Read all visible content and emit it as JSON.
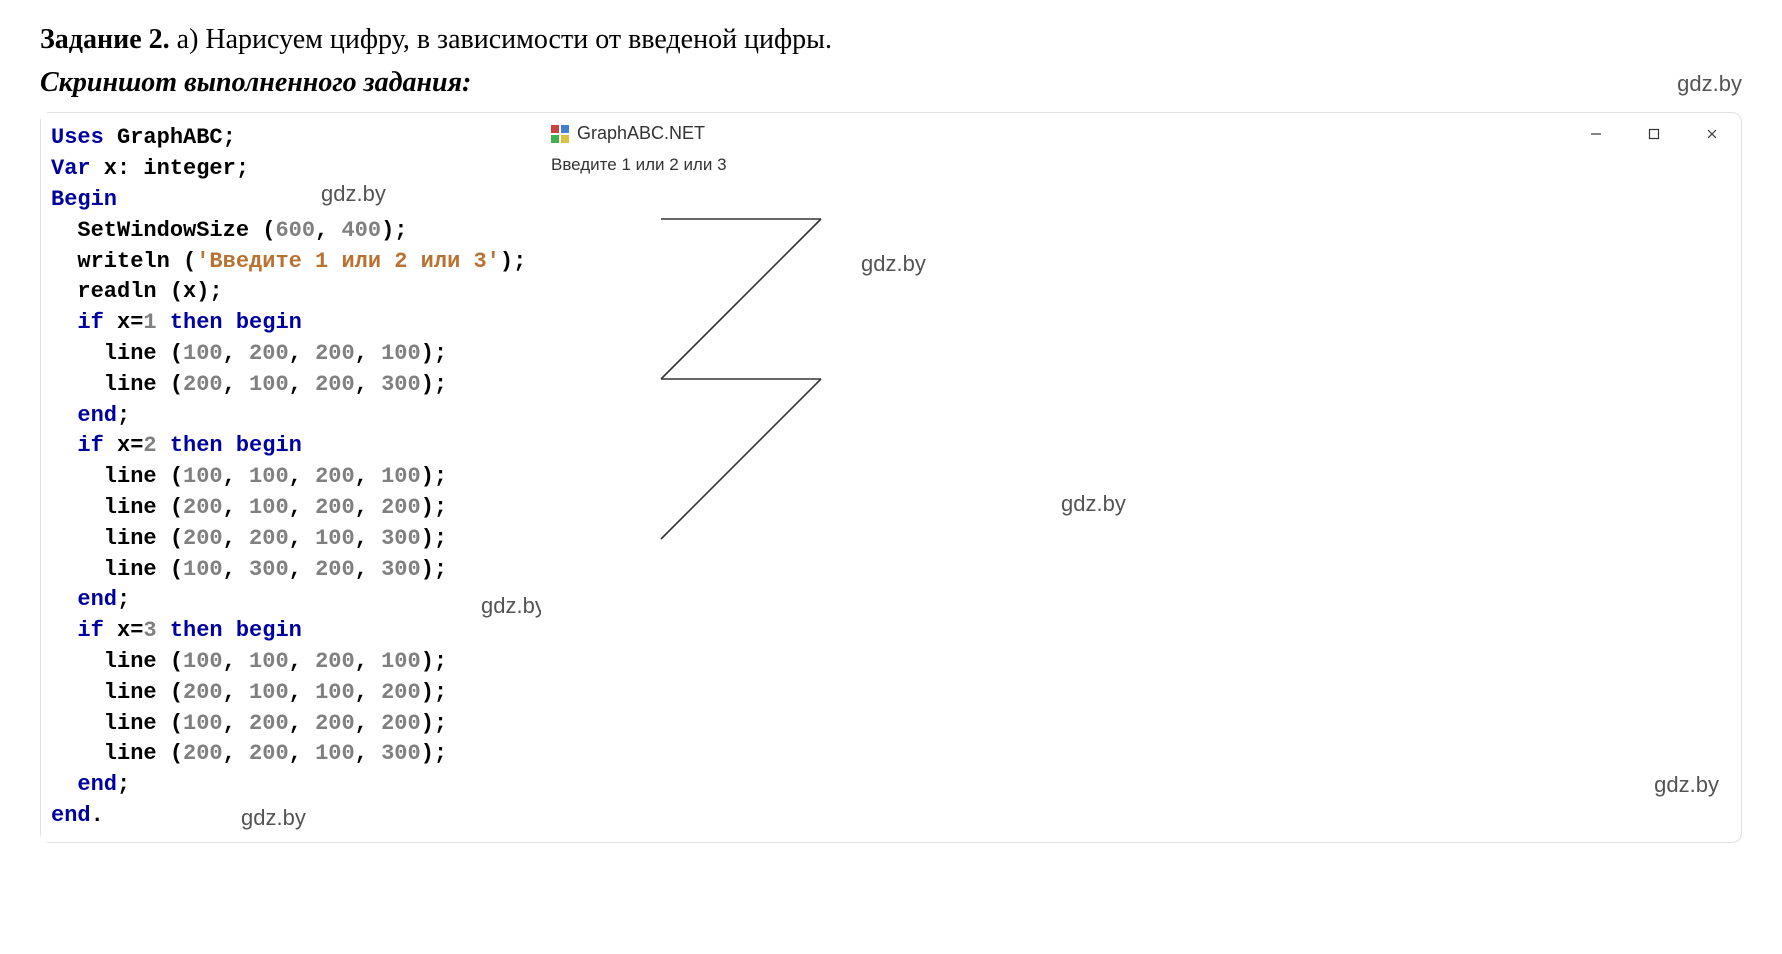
{
  "task": {
    "label": "Задание 2.",
    "letter": "а)",
    "description": "Нарисуем цифру, в зависимости от введеной цифры."
  },
  "subtitle": "Скриншот выполненного задания:",
  "watermark": "gdz.by",
  "code": {
    "lines": [
      [
        {
          "t": "Uses",
          "c": "kw"
        },
        {
          "t": " GraphABC;",
          "c": "punct"
        }
      ],
      [
        {
          "t": "Var",
          "c": "kw"
        },
        {
          "t": " x: ",
          "c": "punct"
        },
        {
          "t": "integer",
          "c": "ident"
        },
        {
          "t": ";",
          "c": "punct"
        }
      ],
      [
        {
          "t": "Begin",
          "c": "kw"
        }
      ],
      [
        {
          "t": "  SetWindowSize (",
          "c": "punct"
        },
        {
          "t": "600",
          "c": "num"
        },
        {
          "t": ", ",
          "c": "punct"
        },
        {
          "t": "400",
          "c": "num"
        },
        {
          "t": ");",
          "c": "punct"
        }
      ],
      [
        {
          "t": "  writeln (",
          "c": "punct"
        },
        {
          "t": "'Введите 1 или 2 или 3'",
          "c": "str"
        },
        {
          "t": ");",
          "c": "punct"
        }
      ],
      [
        {
          "t": "  readln (x);",
          "c": "punct"
        }
      ],
      [
        {
          "t": "  ",
          "c": "punct"
        },
        {
          "t": "if",
          "c": "kw"
        },
        {
          "t": " x=",
          "c": "punct"
        },
        {
          "t": "1",
          "c": "num"
        },
        {
          "t": " ",
          "c": "punct"
        },
        {
          "t": "then",
          "c": "kw"
        },
        {
          "t": " ",
          "c": "punct"
        },
        {
          "t": "begin",
          "c": "kw"
        }
      ],
      [
        {
          "t": "    line (",
          "c": "punct"
        },
        {
          "t": "100",
          "c": "num"
        },
        {
          "t": ", ",
          "c": "punct"
        },
        {
          "t": "200",
          "c": "num"
        },
        {
          "t": ", ",
          "c": "punct"
        },
        {
          "t": "200",
          "c": "num"
        },
        {
          "t": ", ",
          "c": "punct"
        },
        {
          "t": "100",
          "c": "num"
        },
        {
          "t": ");",
          "c": "punct"
        }
      ],
      [
        {
          "t": "    line (",
          "c": "punct"
        },
        {
          "t": "200",
          "c": "num"
        },
        {
          "t": ", ",
          "c": "punct"
        },
        {
          "t": "100",
          "c": "num"
        },
        {
          "t": ", ",
          "c": "punct"
        },
        {
          "t": "200",
          "c": "num"
        },
        {
          "t": ", ",
          "c": "punct"
        },
        {
          "t": "300",
          "c": "num"
        },
        {
          "t": ");",
          "c": "punct"
        }
      ],
      [
        {
          "t": "  ",
          "c": "punct"
        },
        {
          "t": "end",
          "c": "kw"
        },
        {
          "t": ";",
          "c": "punct"
        }
      ],
      [
        {
          "t": "  ",
          "c": "punct"
        },
        {
          "t": "if",
          "c": "kw"
        },
        {
          "t": " x=",
          "c": "punct"
        },
        {
          "t": "2",
          "c": "num"
        },
        {
          "t": " ",
          "c": "punct"
        },
        {
          "t": "then",
          "c": "kw"
        },
        {
          "t": " ",
          "c": "punct"
        },
        {
          "t": "begin",
          "c": "kw"
        }
      ],
      [
        {
          "t": "    line (",
          "c": "punct"
        },
        {
          "t": "100",
          "c": "num"
        },
        {
          "t": ", ",
          "c": "punct"
        },
        {
          "t": "100",
          "c": "num"
        },
        {
          "t": ", ",
          "c": "punct"
        },
        {
          "t": "200",
          "c": "num"
        },
        {
          "t": ", ",
          "c": "punct"
        },
        {
          "t": "100",
          "c": "num"
        },
        {
          "t": ");",
          "c": "punct"
        }
      ],
      [
        {
          "t": "    line (",
          "c": "punct"
        },
        {
          "t": "200",
          "c": "num"
        },
        {
          "t": ", ",
          "c": "punct"
        },
        {
          "t": "100",
          "c": "num"
        },
        {
          "t": ", ",
          "c": "punct"
        },
        {
          "t": "200",
          "c": "num"
        },
        {
          "t": ", ",
          "c": "punct"
        },
        {
          "t": "200",
          "c": "num"
        },
        {
          "t": ");",
          "c": "punct"
        }
      ],
      [
        {
          "t": "    line (",
          "c": "punct"
        },
        {
          "t": "200",
          "c": "num"
        },
        {
          "t": ", ",
          "c": "punct"
        },
        {
          "t": "200",
          "c": "num"
        },
        {
          "t": ", ",
          "c": "punct"
        },
        {
          "t": "100",
          "c": "num"
        },
        {
          "t": ", ",
          "c": "punct"
        },
        {
          "t": "300",
          "c": "num"
        },
        {
          "t": ");",
          "c": "punct"
        }
      ],
      [
        {
          "t": "    line (",
          "c": "punct"
        },
        {
          "t": "100",
          "c": "num"
        },
        {
          "t": ", ",
          "c": "punct"
        },
        {
          "t": "300",
          "c": "num"
        },
        {
          "t": ", ",
          "c": "punct"
        },
        {
          "t": "200",
          "c": "num"
        },
        {
          "t": ", ",
          "c": "punct"
        },
        {
          "t": "300",
          "c": "num"
        },
        {
          "t": ");",
          "c": "punct"
        }
      ],
      [
        {
          "t": "  ",
          "c": "punct"
        },
        {
          "t": "end",
          "c": "kw"
        },
        {
          "t": ";",
          "c": "punct"
        }
      ],
      [
        {
          "t": "  ",
          "c": "punct"
        },
        {
          "t": "if",
          "c": "kw"
        },
        {
          "t": " x=",
          "c": "punct"
        },
        {
          "t": "3",
          "c": "num"
        },
        {
          "t": " ",
          "c": "punct"
        },
        {
          "t": "then",
          "c": "kw"
        },
        {
          "t": " ",
          "c": "punct"
        },
        {
          "t": "begin",
          "c": "kw"
        }
      ],
      [
        {
          "t": "    line (",
          "c": "punct"
        },
        {
          "t": "100",
          "c": "num"
        },
        {
          "t": ", ",
          "c": "punct"
        },
        {
          "t": "100",
          "c": "num"
        },
        {
          "t": ", ",
          "c": "punct"
        },
        {
          "t": "200",
          "c": "num"
        },
        {
          "t": ", ",
          "c": "punct"
        },
        {
          "t": "100",
          "c": "num"
        },
        {
          "t": ");",
          "c": "punct"
        }
      ],
      [
        {
          "t": "    line (",
          "c": "punct"
        },
        {
          "t": "200",
          "c": "num"
        },
        {
          "t": ", ",
          "c": "punct"
        },
        {
          "t": "100",
          "c": "num"
        },
        {
          "t": ", ",
          "c": "punct"
        },
        {
          "t": "100",
          "c": "num"
        },
        {
          "t": ", ",
          "c": "punct"
        },
        {
          "t": "200",
          "c": "num"
        },
        {
          "t": ");",
          "c": "punct"
        }
      ],
      [
        {
          "t": "    line (",
          "c": "punct"
        },
        {
          "t": "100",
          "c": "num"
        },
        {
          "t": ", ",
          "c": "punct"
        },
        {
          "t": "200",
          "c": "num"
        },
        {
          "t": ", ",
          "c": "punct"
        },
        {
          "t": "200",
          "c": "num"
        },
        {
          "t": ", ",
          "c": "punct"
        },
        {
          "t": "200",
          "c": "num"
        },
        {
          "t": ");",
          "c": "punct"
        }
      ],
      [
        {
          "t": "    line (",
          "c": "punct"
        },
        {
          "t": "200",
          "c": "num"
        },
        {
          "t": ", ",
          "c": "punct"
        },
        {
          "t": "200",
          "c": "num"
        },
        {
          "t": ", ",
          "c": "punct"
        },
        {
          "t": "100",
          "c": "num"
        },
        {
          "t": ", ",
          "c": "punct"
        },
        {
          "t": "300",
          "c": "num"
        },
        {
          "t": ");",
          "c": "punct"
        }
      ],
      [
        {
          "t": "  ",
          "c": "punct"
        },
        {
          "t": "end",
          "c": "kw"
        },
        {
          "t": ";",
          "c": "punct"
        }
      ],
      [
        {
          "t": "end",
          "c": "kw"
        },
        {
          "t": ".",
          "c": "punct"
        }
      ]
    ]
  },
  "appWindow": {
    "title": "GraphABC.NET",
    "promptText": "Введите 1 или 2 или 3",
    "drawing": {
      "lines_for_3": [
        [
          100,
          100,
          200,
          100
        ],
        [
          200,
          100,
          100,
          200
        ],
        [
          100,
          200,
          200,
          200
        ],
        [
          200,
          200,
          100,
          300
        ]
      ]
    }
  }
}
